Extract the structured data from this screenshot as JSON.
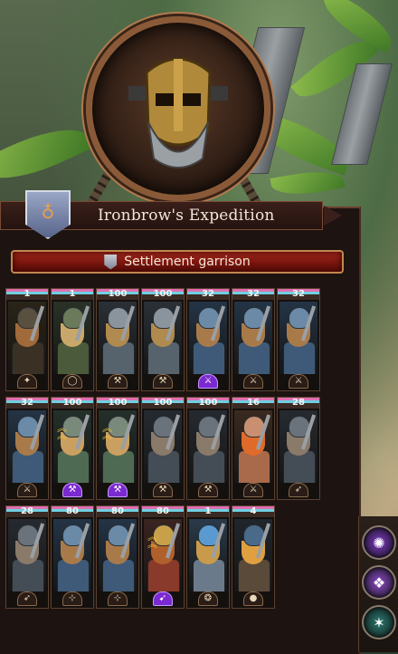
{
  "header": {
    "title": "Ironbrow's Expedition",
    "banner_glyph": "♁"
  },
  "garrison": {
    "label": "Settlement garrison",
    "icon": "shield-icon"
  },
  "units": [
    {
      "count": "1",
      "type": "general",
      "type_glyph": "✦",
      "rank": false,
      "magic": false,
      "palette": "dark-gold"
    },
    {
      "count": "1",
      "type": "engineer",
      "type_glyph": "◯",
      "rank": false,
      "magic": false,
      "palette": "green-hood"
    },
    {
      "count": "100",
      "type": "warriors",
      "type_glyph": "⚒",
      "rank": false,
      "magic": false,
      "palette": "steel"
    },
    {
      "count": "100",
      "type": "warriors",
      "type_glyph": "⚒",
      "rank": false,
      "magic": false,
      "palette": "steel"
    },
    {
      "count": "32",
      "type": "quarrellers",
      "type_glyph": "⚔",
      "rank": false,
      "magic": true,
      "palette": "blue-armor"
    },
    {
      "count": "32",
      "type": "quarrellers",
      "type_glyph": "⚔",
      "rank": false,
      "magic": false,
      "palette": "blue-armor"
    },
    {
      "count": "32",
      "type": "quarrellers",
      "type_glyph": "⚔",
      "rank": false,
      "magic": false,
      "palette": "blue-armor"
    },
    {
      "count": "32",
      "type": "quarrellers",
      "type_glyph": "⚔",
      "rank": false,
      "magic": false,
      "palette": "blue-armor"
    },
    {
      "count": "100",
      "type": "warriors",
      "type_glyph": "⚒",
      "rank": true,
      "magic": true,
      "palette": "green-steel"
    },
    {
      "count": "100",
      "type": "warriors",
      "type_glyph": "⚒",
      "rank": true,
      "magic": true,
      "palette": "green-steel"
    },
    {
      "count": "100",
      "type": "ironbreakers",
      "type_glyph": "⚒",
      "rank": false,
      "magic": false,
      "palette": "dark-steel"
    },
    {
      "count": "100",
      "type": "ironbreakers",
      "type_glyph": "⚒",
      "rank": false,
      "magic": false,
      "palette": "dark-steel"
    },
    {
      "count": "16",
      "type": "slayers",
      "type_glyph": "⚔",
      "rank": false,
      "magic": false,
      "palette": "slayer"
    },
    {
      "count": "28",
      "type": "thunderers",
      "type_glyph": "➶",
      "rank": false,
      "magic": false,
      "palette": "dark-steel"
    },
    {
      "count": "28",
      "type": "thunderers",
      "type_glyph": "➶",
      "rank": false,
      "magic": false,
      "palette": "dark-steel"
    },
    {
      "count": "80",
      "type": "quarrellers",
      "type_glyph": "⊹",
      "rank": false,
      "magic": false,
      "palette": "blue-armor"
    },
    {
      "count": "80",
      "type": "quarrellers",
      "type_glyph": "⊹",
      "rank": false,
      "magic": false,
      "palette": "blue-armor"
    },
    {
      "count": "80",
      "type": "thunderers",
      "type_glyph": "➹",
      "rank": true,
      "magic": true,
      "palette": "red-gold"
    },
    {
      "count": "1",
      "type": "gyrocopter",
      "type_glyph": "❂",
      "rank": false,
      "magic": false,
      "palette": "airship"
    },
    {
      "count": "4",
      "type": "cannon",
      "type_glyph": "●",
      "rank": false,
      "magic": false,
      "palette": "cannon"
    }
  ],
  "side_buttons": [
    {
      "icon": "magic-icon",
      "glyph": "✺",
      "color": "#7a3ac0"
    },
    {
      "icon": "arcane-icon",
      "glyph": "❖",
      "color": "#8a4ac8"
    },
    {
      "icon": "rune-icon",
      "glyph": "✶",
      "color": "#2a7a70"
    }
  ]
}
